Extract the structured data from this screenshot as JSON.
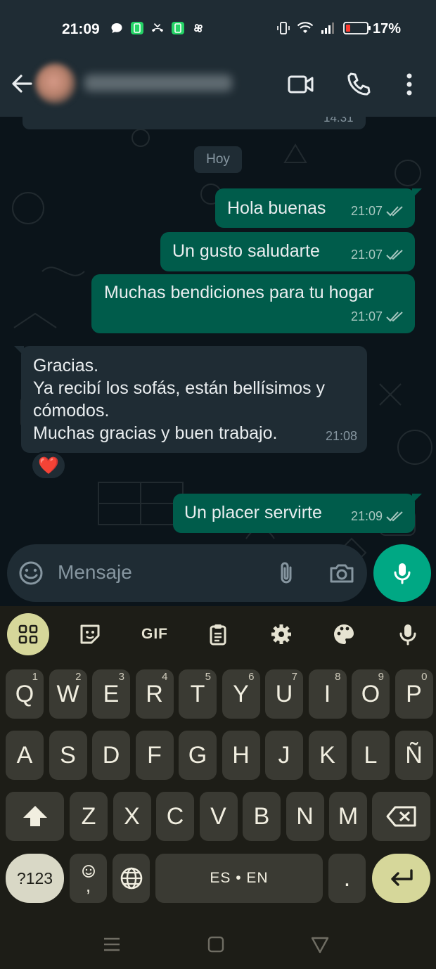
{
  "status_bar": {
    "time": "21:09",
    "battery": "17%",
    "left_icons": [
      "chat-bubble-icon",
      "app-green-icon",
      "missed-call-icon",
      "app-green-icon",
      "pinwheel-icon"
    ],
    "right_icons": [
      "vibrate-icon",
      "wifi-icon",
      "signal-icon",
      "battery-low-icon"
    ]
  },
  "header": {
    "icons": [
      "back-arrow-icon",
      "video-call-icon",
      "phone-icon",
      "more-vert-icon"
    ]
  },
  "chat": {
    "previous_time": "14:31",
    "date_chip": "Hoy",
    "messages": [
      {
        "direction": "out",
        "text": "Hola buenas",
        "time": "21:07",
        "status": "read"
      },
      {
        "direction": "out",
        "text": "Un gusto saludarte",
        "time": "21:07",
        "status": "read"
      },
      {
        "direction": "out",
        "text": "Muchas bendiciones para tu hogar",
        "time": "21:07",
        "status": "read"
      },
      {
        "direction": "in",
        "lines": [
          "Gracias.",
          "Ya recibí los sofás, están bellísimos y",
          "cómodos.",
          "Muchas gracias y buen trabajo."
        ],
        "time": "21:08",
        "reaction": "❤️"
      },
      {
        "direction": "out",
        "text": "Un placer servirte",
        "time": "21:09",
        "status": "read"
      }
    ]
  },
  "composer": {
    "placeholder": "Mensaje",
    "icons": [
      "emoji-icon",
      "attach-icon",
      "camera-icon",
      "mic-icon"
    ]
  },
  "keyboard": {
    "toolbar": {
      "gif_label": "GIF",
      "icons": [
        "apps-grid-icon",
        "sticker-icon",
        "clipboard-icon",
        "settings-gear-icon",
        "palette-icon",
        "voice-mic-icon"
      ]
    },
    "row1": [
      {
        "k": "Q",
        "h": "1"
      },
      {
        "k": "W",
        "h": "2"
      },
      {
        "k": "E",
        "h": "3"
      },
      {
        "k": "R",
        "h": "4"
      },
      {
        "k": "T",
        "h": "5"
      },
      {
        "k": "Y",
        "h": "6"
      },
      {
        "k": "U",
        "h": "7"
      },
      {
        "k": "I",
        "h": "8"
      },
      {
        "k": "O",
        "h": "9"
      },
      {
        "k": "P",
        "h": "0"
      }
    ],
    "row2": [
      "A",
      "S",
      "D",
      "F",
      "G",
      "H",
      "J",
      "K",
      "L",
      "Ñ"
    ],
    "row3": [
      "Z",
      "X",
      "C",
      "V",
      "B",
      "N",
      "M"
    ],
    "sym_label": "?123",
    "comma_label": ",",
    "space_label": "ES • EN",
    "period_label": "."
  },
  "colors": {
    "outgoing_bubble": "#005c4b",
    "incoming_bubble": "#1f2c34",
    "accent": "#00a884",
    "keyboard_accent": "#d6d79a"
  }
}
